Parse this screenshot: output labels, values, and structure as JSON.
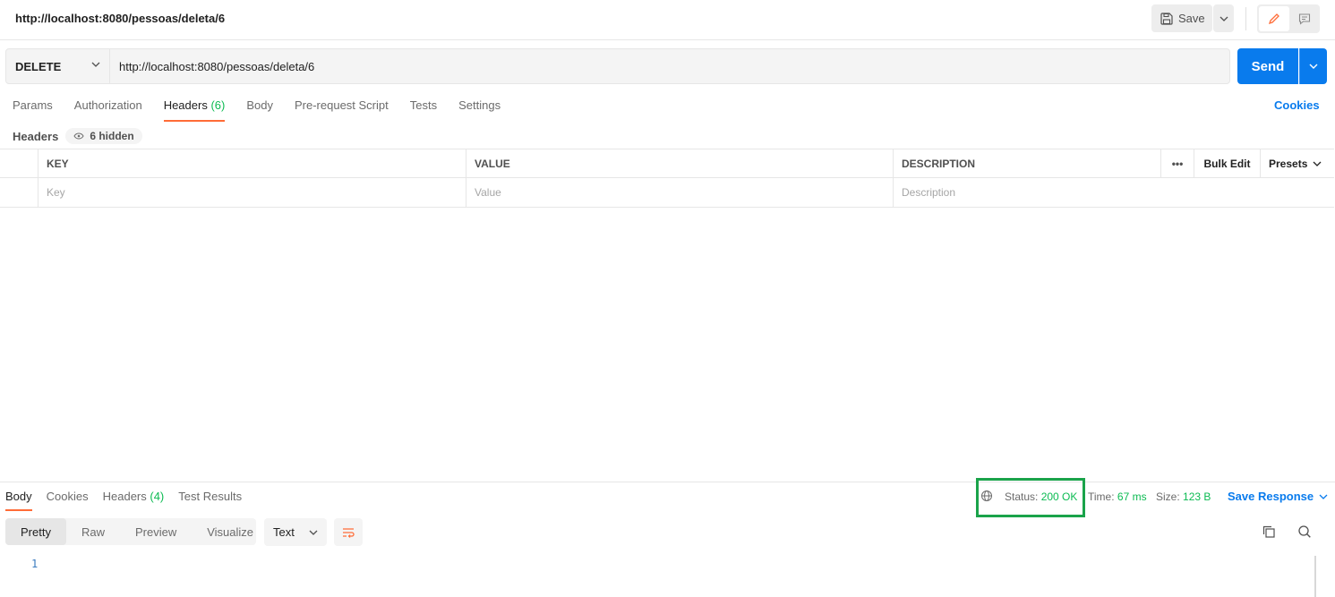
{
  "window": {
    "title": "http://localhost:8080/pessoas/deleta/6"
  },
  "toolbar": {
    "save_label": "Save",
    "save_icon": "floppy-icon",
    "edit_icon": "pencil-icon",
    "comment_icon": "comment-icon"
  },
  "request": {
    "method": "DELETE",
    "url": "http://localhost:8080/pessoas/deleta/6",
    "send_label": "Send"
  },
  "request_tabs": {
    "params": "Params",
    "authorization": "Authorization",
    "headers": "Headers",
    "headers_count": "(6)",
    "body": "Body",
    "prerequest": "Pre-request Script",
    "tests": "Tests",
    "settings": "Settings",
    "cookies": "Cookies"
  },
  "headers_panel": {
    "label": "Headers",
    "hidden": "6 hidden",
    "columns": {
      "key": "KEY",
      "value": "VALUE",
      "description": "DESCRIPTION",
      "more": "•••",
      "bulk_edit": "Bulk Edit",
      "presets": "Presets"
    },
    "placeholders": {
      "key": "Key",
      "value": "Value",
      "description": "Description"
    }
  },
  "response": {
    "tabs": {
      "body": "Body",
      "cookies": "Cookies",
      "headers": "Headers",
      "headers_count": "(4)",
      "test_results": "Test Results"
    },
    "status_label": "Status:",
    "status_value": "200 OK",
    "time_label": "Time:",
    "time_value": "67 ms",
    "size_label": "Size:",
    "size_value": "123 B",
    "save_response": "Save Response",
    "views": {
      "pretty": "Pretty",
      "raw": "Raw",
      "preview": "Preview",
      "visualize": "Visualize"
    },
    "format": "Text",
    "line_number": "1"
  },
  "colors": {
    "accent": "#097bed",
    "tab_active": "#ff6c37",
    "success": "#0cbb52",
    "highlight_box": "#1aa34a"
  }
}
